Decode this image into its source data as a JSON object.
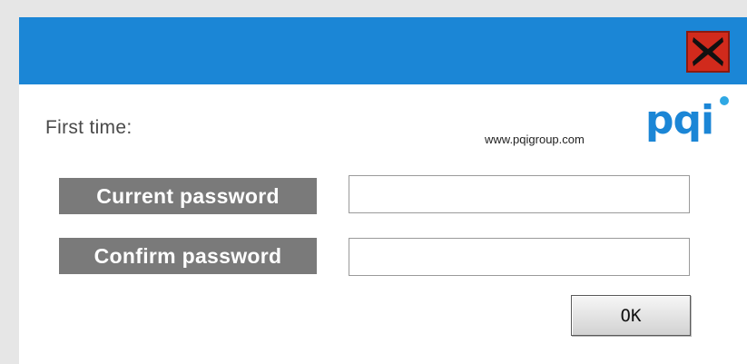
{
  "dialog": {
    "close_icon": "close-x-icon",
    "titlebar_color": "#1b86d6",
    "close_color": "#d12a1c"
  },
  "header": {
    "first_time_label": "First time:",
    "website": "www.pqigroup.com",
    "logo_text": "pqi",
    "logo_color": "#1b86d6"
  },
  "form": {
    "current_password_label": "Current password",
    "current_password_value": "",
    "confirm_password_label": "Confirm password",
    "confirm_password_value": "",
    "ok_label": "OK"
  }
}
